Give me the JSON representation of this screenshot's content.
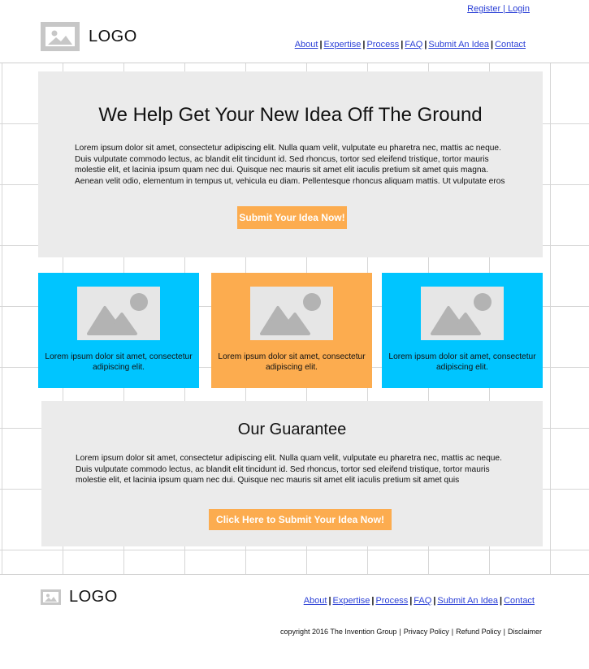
{
  "header": {
    "register_login": "Register | Login",
    "logo_text": "LOGO",
    "nav": [
      "About",
      "Expertise",
      "Process",
      "FAQ",
      "Submit An Idea",
      "Contact"
    ]
  },
  "hero": {
    "title": "We Help Get Your New Idea Off The Ground",
    "body": "Lorem ipsum dolor sit amet, consectetur adipiscing elit. Nulla quam velit, vulputate eu pharetra nec, mattis ac neque. Duis vulputate commodo lectus, ac blandit elit tincidunt id. Sed rhoncus, tortor sed eleifend tristique, tortor mauris molestie elit, et lacinia ipsum quam nec dui. Quisque nec mauris sit amet elit iaculis pretium sit amet quis magna. Aenean velit odio, elementum in tempus ut, vehicula eu diam. Pellentesque rhoncus aliquam mattis. Ut vulputate eros",
    "button": "Submit Your Idea Now!"
  },
  "cards": [
    {
      "text": "Lorem ipsum dolor sit amet, consectetur adipiscing elit.",
      "color": "#00c5ff"
    },
    {
      "text": "Lorem ipsum dolor sit amet, consectetur adipiscing elit.",
      "color": "#fcac4f"
    },
    {
      "text": "Lorem ipsum dolor sit amet, consectetur adipiscing elit.",
      "color": "#00c5ff"
    }
  ],
  "guarantee": {
    "title": "Our Guarantee",
    "body": "Lorem ipsum dolor sit amet, consectetur adipiscing elit. Nulla quam velit, vulputate eu pharetra nec, mattis ac neque. Duis vulputate commodo lectus, ac blandit elit tincidunt id. Sed rhoncus, tortor sed eleifend tristique, tortor mauris molestie elit, et lacinia ipsum quam nec dui. Quisque nec mauris sit amet elit iaculis pretium sit amet quis",
    "button": "Click Here to Submit Your Idea Now!"
  },
  "footer": {
    "logo_text": "LOGO",
    "nav": [
      "About",
      "Expertise",
      "Process",
      "FAQ",
      "Submit An Idea",
      "Contact"
    ],
    "copyright": "copyright 2016 The Invention Group",
    "links": [
      "Privacy Policy",
      "Refund Policy",
      "Disclaimer"
    ]
  },
  "colors": {
    "accent_blue": "#00c5ff",
    "accent_orange": "#fcac4f",
    "panel_gray": "#ebebeb",
    "placeholder_gray": "#c7c7c7",
    "link": "#2a3fd6"
  },
  "icons": [
    "image-placeholder-icon"
  ]
}
